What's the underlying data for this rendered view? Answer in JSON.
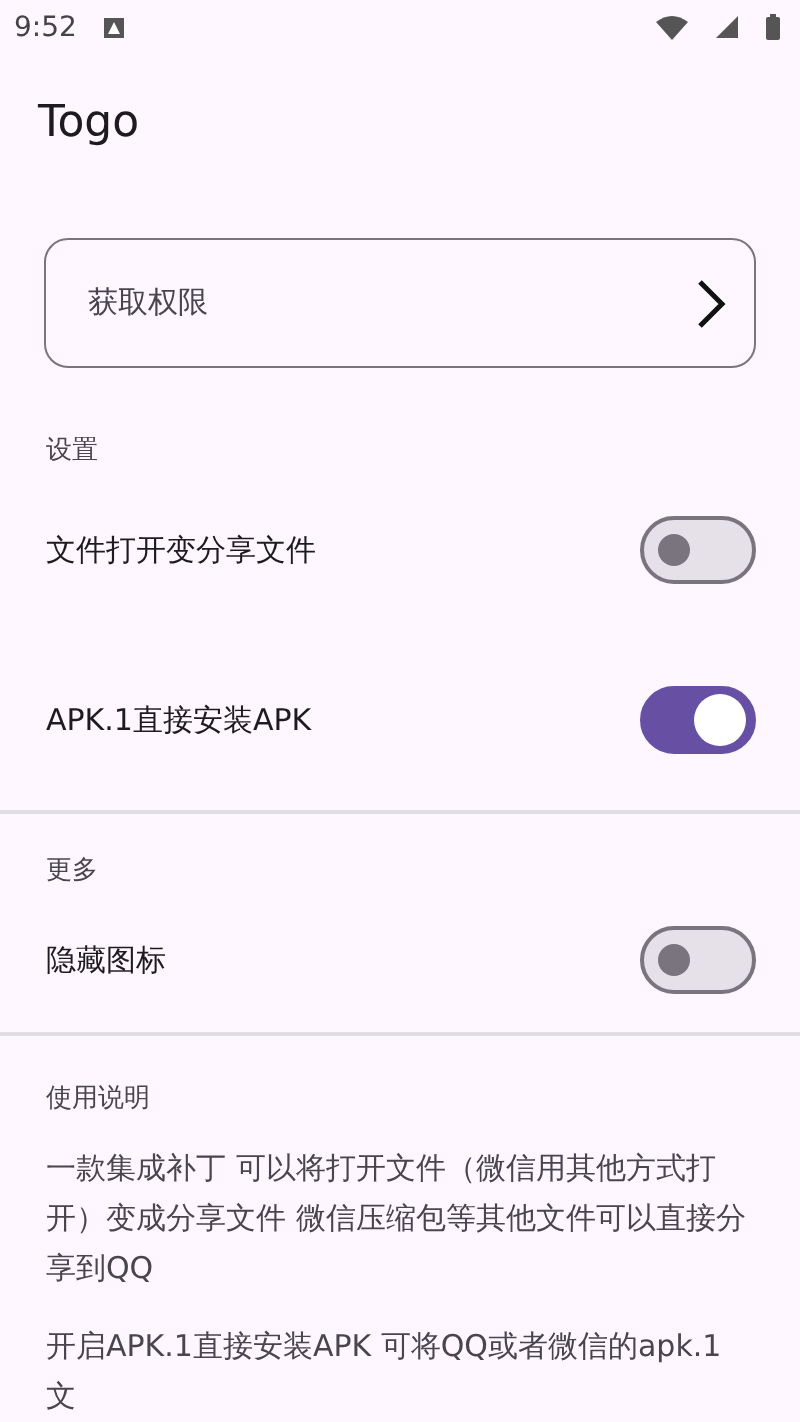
{
  "status_bar": {
    "time": "9:52"
  },
  "app_bar": {
    "title": "Togo"
  },
  "permission_card": {
    "label": "获取权限"
  },
  "sections": [
    {
      "header": "设置",
      "divider": false,
      "rows": [
        {
          "label": "文件打开变分享文件",
          "on": false
        },
        {
          "label": "APK.1直接安装APK",
          "on": true
        }
      ]
    },
    {
      "header": "更多",
      "divider": true,
      "rows": [
        {
          "label": "隐藏图标",
          "on": false
        }
      ]
    }
  ],
  "instructions": {
    "header": "使用说明",
    "paragraphs": [
      "一款集成补丁 可以将打开文件（微信用其他方式打开）变成分享文件 微信压缩包等其他文件可以直接分享到QQ",
      "开启APK.1直接安装APK 可将QQ或者微信的apk.1文"
    ]
  }
}
